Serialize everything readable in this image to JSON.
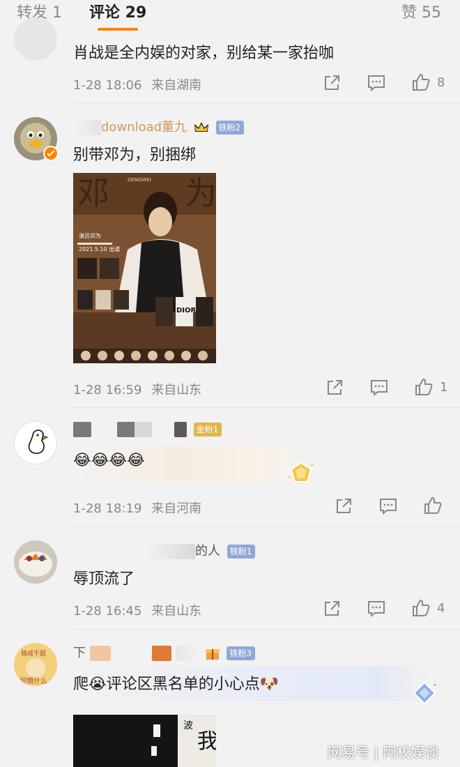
{
  "tabs": {
    "reposts": "转发 1",
    "comments": "评论 29",
    "likes": "赞 55"
  },
  "colors": {
    "accent": "#ff8200",
    "iron_badge": "#8fa8d8",
    "gold_badge": "#e3b44a"
  },
  "comments": [
    {
      "text": "肖战是全内娱的对家，别给某一家抬咖",
      "date": "1-28 18:06",
      "location": "来自湖南",
      "like_count": "8"
    },
    {
      "username": "download董九",
      "badge": "铁粉2",
      "text": "别带邓为，别捆绑",
      "date": "1-28 16:59",
      "location": "来自山东",
      "like_count": "1",
      "poster": {
        "actor": "演员邓为",
        "debut": "2021.5.10 出道",
        "brand": "DIOR",
        "brand_small": "DIOR"
      }
    },
    {
      "badge": "金粉1",
      "emoji": "😂😂😂😂",
      "date": "1-28 18:19",
      "location": "来自河南",
      "like_count": ""
    },
    {
      "username_suffix": "的人",
      "badge": "铁粉1",
      "text": "辱顶流了",
      "date": "1-28 16:45",
      "location": "来自山东",
      "like_count": "4"
    },
    {
      "username_prefix": "下",
      "badge": "铁粉3",
      "text_prefix": "爬",
      "text_suffix": "评论区黑名单的小心点",
      "avatar_text": "何惧什么",
      "avatar_text_top": "独成千题",
      "image_text_1": "我",
      "image_text_2": "波"
    }
  ],
  "watermark": "网易号 | 阿校娱谈"
}
